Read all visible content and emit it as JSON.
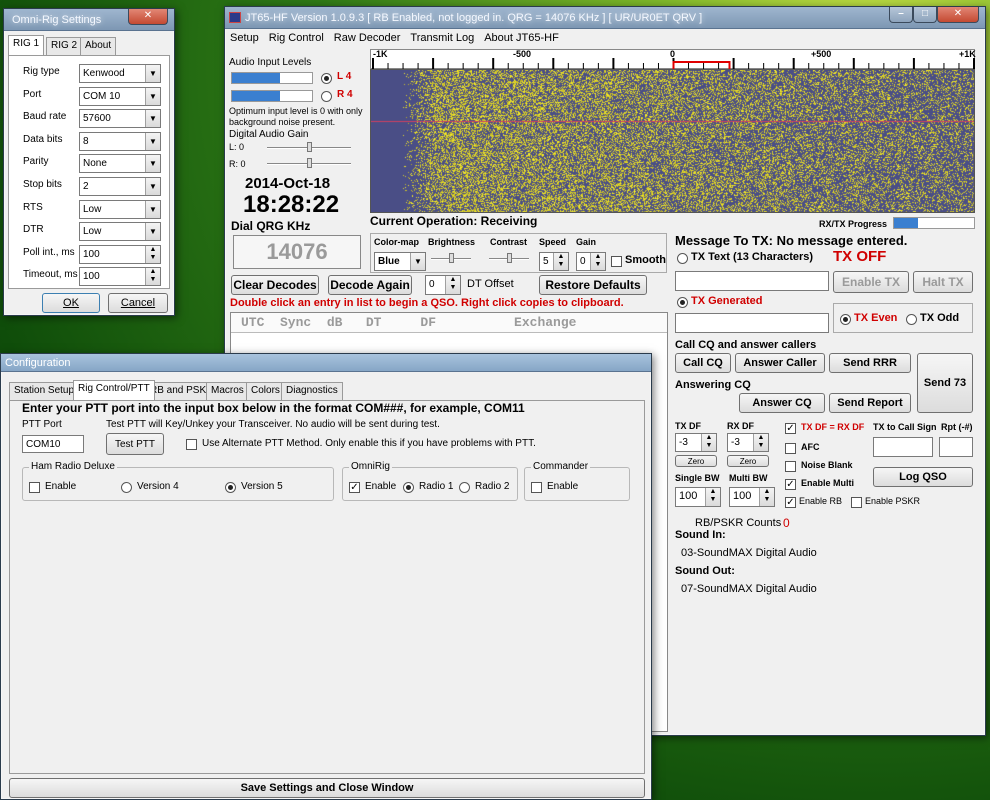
{
  "omnirig": {
    "title": "Omni-Rig Settings",
    "close_label": "✕",
    "tabs": [
      "RIG 1",
      "RIG 2",
      "About"
    ],
    "rows": [
      {
        "label": "Rig type",
        "value": "Kenwood",
        "kind": "select"
      },
      {
        "label": "Port",
        "value": "COM 10",
        "kind": "select"
      },
      {
        "label": "Baud rate",
        "value": "57600",
        "kind": "select"
      },
      {
        "label": "Data bits",
        "value": "8",
        "kind": "select"
      },
      {
        "label": "Parity",
        "value": "None",
        "kind": "select"
      },
      {
        "label": "Stop bits",
        "value": "2",
        "kind": "select"
      },
      {
        "label": "RTS",
        "value": "Low",
        "kind": "select"
      },
      {
        "label": "DTR",
        "value": "Low",
        "kind": "select"
      },
      {
        "label": "Poll int., ms",
        "value": "100",
        "kind": "spin"
      },
      {
        "label": "Timeout, ms",
        "value": "100",
        "kind": "spin"
      }
    ],
    "ok_label": "OK",
    "cancel_label": "Cancel"
  },
  "main": {
    "title": "JT65-HF Version 1.0.9.3  [ RB Enabled, not logged in.  QRG = 14076 KHz ] [ UR/UR0ET QRV ]",
    "menu": [
      "Setup",
      "Rig Control",
      "Raw Decoder",
      "Transmit Log",
      "About JT65-HF"
    ],
    "audio_levels_label": "Audio Input Levels",
    "level_l": "L 4",
    "level_r": "R 4",
    "level_note": "Optimum input level is 0 with only background noise present.",
    "gain_label": "Digital Audio Gain",
    "gain_l": "L: 0",
    "gain_r": "R: 0",
    "date": "2014-Oct-18",
    "time": "18:28:22",
    "dial_label": "Dial QRG KHz",
    "dial_value": "14076",
    "scale_labels": [
      "-1K",
      "-500",
      "0",
      "+500",
      "+1K"
    ],
    "current_op": "Current Operation:  Receiving",
    "progress_label": "RX/TX Progress",
    "progress_fraction": 0.3,
    "colormap_label": "Color-map",
    "colormap_value": "Blue",
    "brightness_label": "Brightness",
    "contrast_label": "Contrast",
    "speed_label": "Speed",
    "speed_value": "5",
    "gain_ctl_label": "Gain",
    "gain_ctl_value": "0",
    "smooth_label": "Smooth",
    "clear_decodes": "Clear Decodes",
    "decode_again": "Decode Again",
    "dt_value": "0",
    "dt_label": "DT Offset",
    "restore_defaults": "Restore Defaults",
    "hint": "Double click an entry in list to begin a QSO.  Right click copies to clipboard.",
    "columns": "UTC  Sync  dB   DT     DF          Exchange",
    "msg_to_tx": "Message To TX:  No message entered.",
    "tx_text_label": "TX Text (13 Characters)",
    "tx_off": "TX OFF",
    "enable_tx": "Enable TX",
    "halt_tx": "Halt TX",
    "tx_generated": "TX Generated",
    "tx_even": "TX Even",
    "tx_odd": "TX Odd",
    "call_cq_header": "Call CQ and answer callers",
    "call_cq": "Call CQ",
    "answer_caller": "Answer Caller",
    "send_rrr": "Send RRR",
    "send_73": "Send 73",
    "answering_cq": "Answering CQ",
    "answer_cq": "Answer CQ",
    "send_report": "Send Report",
    "tx_df_label": "TX DF",
    "tx_df_value": "-3",
    "rx_df_label": "RX DF",
    "rx_df_value": "-3",
    "zero_label": "Zero",
    "txdf_eq_rxdf": "TX DF = RX DF",
    "tx_to_call": "TX to Call Sign",
    "rpt_label": "Rpt (-#)",
    "afc": "AFC",
    "noise_blank": "Noise Blank",
    "enable_multi": "Enable Multi",
    "single_bw_label": "Single BW",
    "single_bw_value": "100",
    "multi_bw_label": "Multi BW",
    "multi_bw_value": "100",
    "log_qso": "Log QSO",
    "enable_rb": "Enable RB",
    "enable_pskr": "Enable PSKR",
    "rb_counts_label": "RB/PSKR Counts",
    "rb_counts_value": "0",
    "sound_in_label": "Sound In:",
    "sound_in_value": "03-SoundMAX Digital Audio",
    "sound_out_label": "Sound Out:",
    "sound_out_value": "07-SoundMAX Digital Audio"
  },
  "config": {
    "title": "Configuration",
    "tabs": [
      "Station Setup",
      "Rig Control/PTT",
      "RB and PSKR",
      "Macros",
      "Colors",
      "Diagnostics"
    ],
    "heading": "Enter your PTT port into the input box below in the format COM###, for example, COM11",
    "ptt_port_label": "PTT Port",
    "ptt_port_value": "COM10",
    "test_note": "Test PTT will Key/Unkey your Transceiver.  No audio will be sent during test.",
    "test_ptt": "Test PTT",
    "alt_ptt": "Use Alternate PTT Method.  Only enable this if you have problems with PTT.",
    "hrd_group": "Ham Radio Deluxe",
    "hrd_enable": "Enable",
    "hrd_v4": "Version 4",
    "hrd_v5": "Version 5",
    "omnirig_group": "OmniRig",
    "omni_enable": "Enable",
    "omni_r1": "Radio 1",
    "omni_r2": "Radio 2",
    "commander_group": "Commander",
    "cmd_enable": "Enable",
    "save": "Save Settings and Close Window"
  },
  "colors": {
    "waterfall_bg": "#4a4e86",
    "waterfall_dots": "#e8e23a",
    "alert_red": "#d00000",
    "progress_blue": "#3a7fd0"
  }
}
